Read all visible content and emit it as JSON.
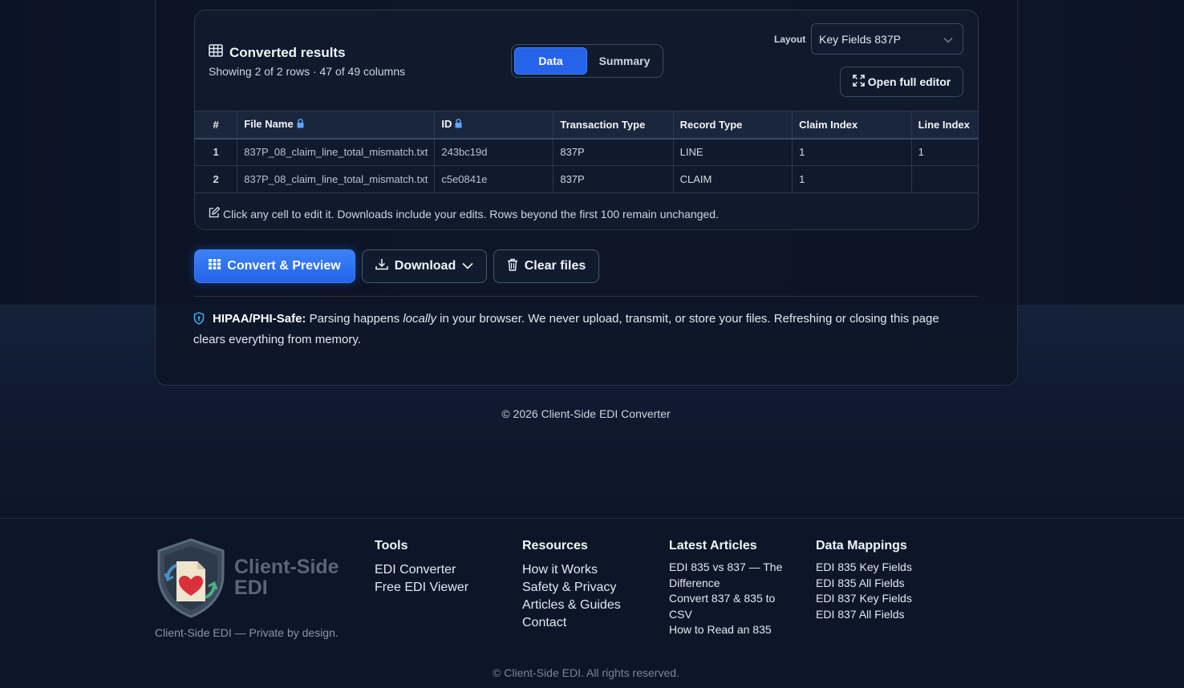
{
  "results": {
    "title": "Converted results",
    "subtitle": "Showing 2 of 2 rows · 47 of 49 columns",
    "toggle": {
      "data": "Data",
      "summary": "Summary",
      "active": "Data"
    },
    "layout_label": "Layout",
    "layout_value": "Key Fields 837P",
    "open_editor": "Open full editor",
    "columns": [
      "#",
      "File Name",
      "ID",
      "Transaction Type",
      "Record Type",
      "Claim Index",
      "Line Index"
    ],
    "rows": [
      [
        "1",
        "837P_08_claim_line_total_mismatch.txt",
        "243bc19d",
        "837P",
        "LINE",
        "1",
        "1"
      ],
      [
        "2",
        "837P_08_claim_line_total_mismatch.txt",
        "c5e0841e",
        "837P",
        "CLAIM",
        "1",
        ""
      ]
    ],
    "note": "Click any cell to edit it. Downloads include your edits. Rows beyond the first 100 remain unchanged."
  },
  "actions": {
    "convert": "Convert & Preview",
    "download": "Download",
    "clear": "Clear files"
  },
  "hipaa": {
    "label": "HIPAA/PHI-Safe:",
    "pre": " Parsing happens ",
    "em": "locally",
    "post": " in your browser. We never upload, transmit, or store your files. Refreshing or closing this page clears everything from memory."
  },
  "copyright": "© 2026 Client-Side EDI Converter",
  "footer": {
    "logo_line1": "Client-Side",
    "logo_line2": "EDI",
    "tagline": "Client-Side EDI — Private by design.",
    "tools": {
      "title": "Tools",
      "links": [
        "EDI Converter",
        "Free EDI Viewer"
      ]
    },
    "resources": {
      "title": "Resources",
      "links": [
        "How it Works",
        "Safety & Privacy",
        "Articles & Guides",
        "Contact"
      ]
    },
    "articles": {
      "title": "Latest Articles",
      "links": [
        "EDI 835 vs 837 — The",
        "Difference",
        "Convert 837 & 835 to",
        "CSV",
        "How to Read an 835"
      ]
    },
    "mappings": {
      "title": "Data Mappings",
      "links": [
        "EDI 835 Key Fields",
        "EDI 835 All Fields",
        "EDI 837 Key Fields",
        "EDI 837 All Fields"
      ]
    },
    "rights": "© Client-Side EDI. All rights reserved."
  },
  "colors": {
    "accent": "#2563eb",
    "background": "#0d1629",
    "panel": "#0f1a2d"
  }
}
